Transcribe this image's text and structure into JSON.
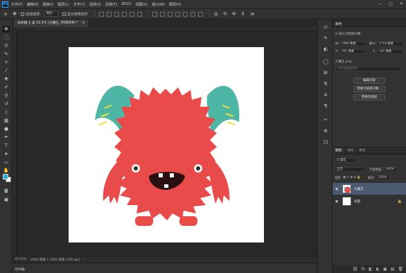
{
  "menubar": {
    "logo": "Ps",
    "items": [
      "文件(F)",
      "编辑(E)",
      "图像(I)",
      "图层(L)",
      "文字(Y)",
      "选择(S)",
      "滤镜(T)",
      "3D(D)",
      "视图(V)",
      "窗口(W)",
      "帮助(H)"
    ],
    "win_controls": [
      "—",
      "▢",
      "✕"
    ]
  },
  "options": {
    "auto_select_label": "自动选择:",
    "auto_select_value": "图层",
    "transform_label": "显示变换控件"
  },
  "document": {
    "tab_title": "未标题-1 @ 33.3% (大魔王, RGB/8#) *",
    "close": "×"
  },
  "status": {
    "zoom": "33.33%",
    "doc_info": "2000 像素 x 2000 像素 (300 ppi)",
    "arrow": "›"
  },
  "timeline_label": "时间轴",
  "properties": {
    "title": "属性",
    "type_label": "嵌入的智能对象",
    "w_label": "W:",
    "w_value": "1969 像素",
    "h_label": "H:",
    "h_value": "1719 像素",
    "x_label": "X:",
    "x_value": "265 像素",
    "y_label": "Y:",
    "y_value": "141 像素",
    "file_name": "大魔王.png",
    "comp_placeholder": "不应用图层复合",
    "btn_edit": "编辑内容",
    "btn_convert_linked": "转换为链接对象...",
    "btn_convert_layers": "转换为图层"
  },
  "layers": {
    "tabs": [
      "图层",
      "通道",
      "路径"
    ],
    "kind_label": "Q 类型",
    "blend_mode": "正常",
    "opacity_label": "不透明度:",
    "opacity_value": "100%",
    "lock_label": "锁定:",
    "fill_label": "填充:",
    "fill_value": "100%",
    "items": [
      {
        "name": "大魔王",
        "selected": true
      },
      {
        "name": "背景",
        "selected": false
      }
    ]
  },
  "icons": {
    "eye": "◉",
    "lock": "🔒",
    "footer": [
      "⛓",
      "fx",
      "◧",
      "◐",
      "▣",
      "▤",
      "🗑"
    ]
  },
  "colors": {
    "foreground": "#29a9d6",
    "background": "#ffffff",
    "monster_body": "#e94b4b",
    "horn": "#4db6a4"
  }
}
